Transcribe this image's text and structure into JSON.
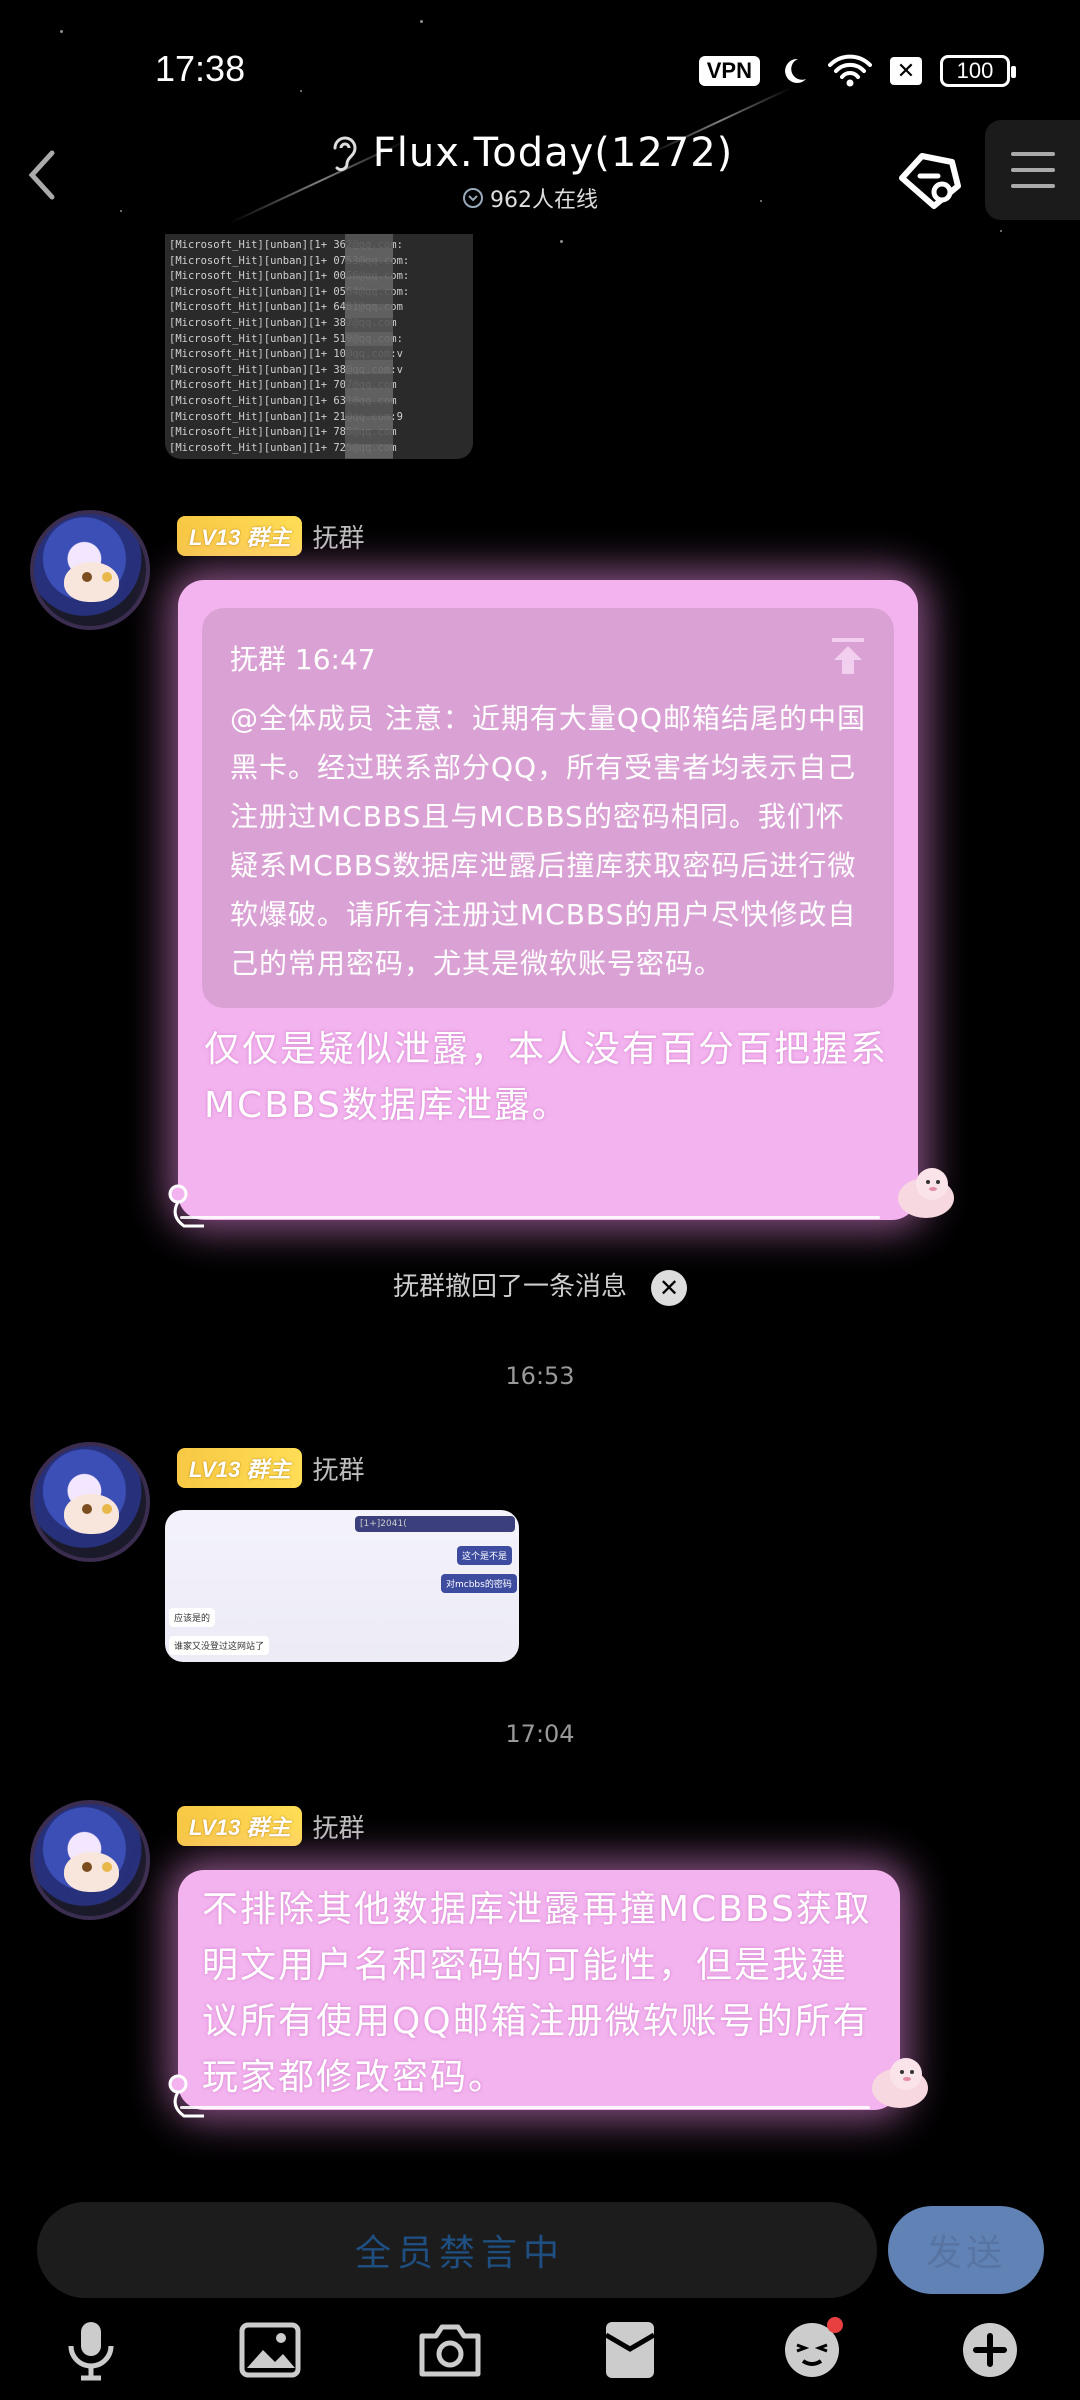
{
  "status_bar": {
    "time": "17:38",
    "vpn": "VPN",
    "battery": "100"
  },
  "header": {
    "title": "Flux.Today(1272)",
    "online": "962人在线"
  },
  "screenshot_lines": [
    "[Microsoft_Hit][unban][1+        362@qq.com:",
    "[Microsoft_Hit][unban][1+        0753@qq.com:",
    "[Microsoft_Hit][unban][1+        0056@qq.com:",
    "[Microsoft_Hit][unban][1+        0564@qq.com:",
    "[Microsoft_Hit][unban][1+        6481@qq.com",
    "[Microsoft_Hit][unban][1+        387@qq.com",
    "[Microsoft_Hit][unban][1+        519@qq.com:",
    "[Microsoft_Hit][unban][1+        10@qq.com:v",
    "[Microsoft_Hit][unban][1+        38@qq.com:v",
    "[Microsoft_Hit][unban][1+        707@qq.com",
    "[Microsoft_Hit][unban][1+        631@qq.com",
    "[Microsoft_Hit][unban][1+        21@qq.com:9",
    "[Microsoft_Hit][unban][1+        788@qq.com",
    "[Microsoft_Hit][unban][1+        725@qq.com"
  ],
  "messages": [
    {
      "badge": "LV13 群主",
      "sender": "抚群",
      "quote_head": "抚群 16:47",
      "quote_text": "@全体成员 注意：近期有大量QQ邮箱结尾的中国黑卡。经过联系部分QQ，所有受害者均表示自己注册过MCBBS且与MCBBS的密码相同。我们怀疑系MCBBS数据库泄露后撞库获取密码后进行微软爆破。请所有注册过MCBBS的用户尽快修改自己的常用密码，尤其是微软账号密码。",
      "text": "仅仅是疑似泄露，本人没有百分百把握系MCBBS数据库泄露。"
    },
    {
      "badge": "LV13 群主",
      "sender": "抚群"
    },
    {
      "badge": "LV13 群主",
      "sender": "抚群",
      "text": "不排除其他数据库泄露再撞MCBBS获取明文用户名和密码的可能性，但是我建议所有使用QQ邮箱注册微软账号的所有玩家都修改密码。"
    }
  ],
  "system": {
    "recall": "抚群撤回了一条消息"
  },
  "timestamps": [
    "16:53",
    "17:04"
  ],
  "chat_image_texts": [
    "[1+]2041(",
    "这个是不是",
    "对mcbbs的密码",
    "应该是的",
    "谁家又没登过这网站了"
  ],
  "input": {
    "placeholder": "全员禁言中",
    "send": "发送"
  },
  "toolbar": [
    "mic-icon",
    "image-icon",
    "camera-icon",
    "red-packet-icon",
    "emoji-icon",
    "plus-icon"
  ],
  "colors": {
    "bubble": "#f3b3ef",
    "quote": "#daa2d4",
    "badge": "#f7c844",
    "send": "#6182b4"
  }
}
